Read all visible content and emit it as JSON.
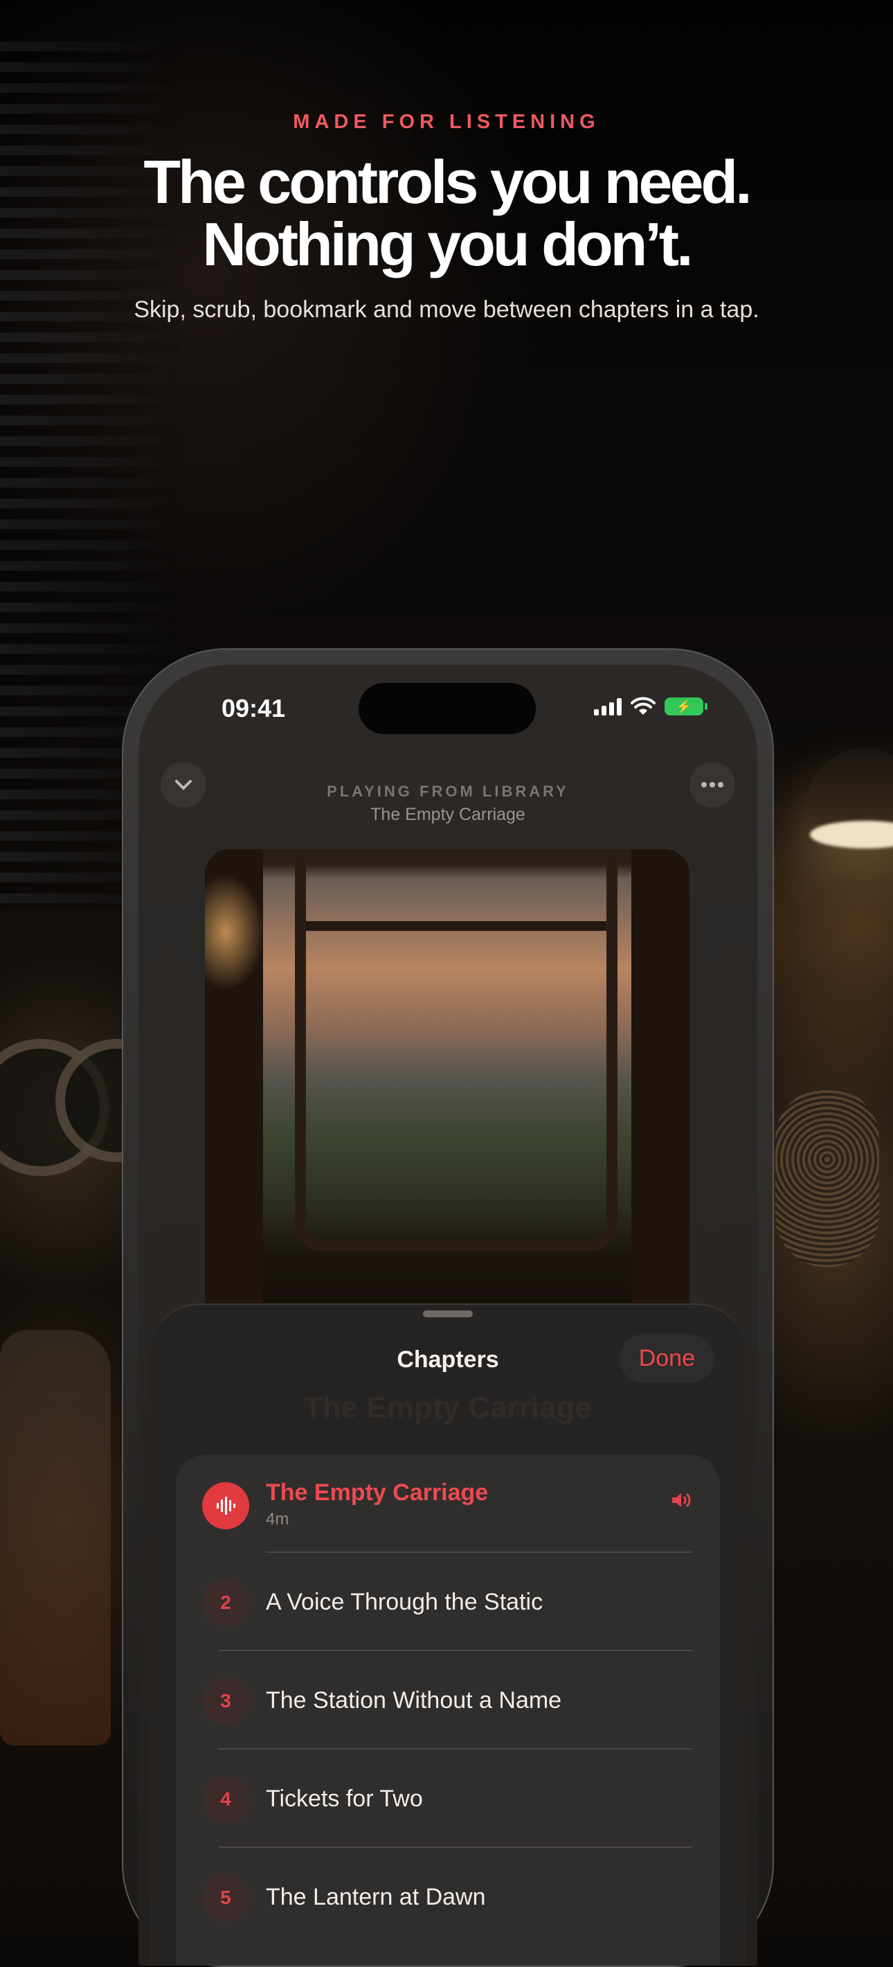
{
  "marketing": {
    "eyebrow": "MADE FOR LISTENING",
    "headline_line1": "The controls you need.",
    "headline_line2": "Nothing you don’t.",
    "subhead": "Skip, scrub, bookmark and move between chapters in a tap."
  },
  "status_bar": {
    "time": "09:41",
    "icons": [
      "cellular-signal-icon",
      "wifi-icon",
      "battery-charging-icon"
    ],
    "battery_color": "#34c759"
  },
  "player": {
    "playing_from": "PLAYING FROM LIBRARY",
    "title": "The Empty Carriage"
  },
  "sheet": {
    "title": "Chapters",
    "done_label": "Done",
    "ghost_title": "The Empty Carriage",
    "chapters": [
      {
        "number": "",
        "title": "The Empty Carriage",
        "duration": "4m",
        "active": true
      },
      {
        "number": "2",
        "title": "A Voice Through the Static"
      },
      {
        "number": "3",
        "title": "The Station Without a Name"
      },
      {
        "number": "4",
        "title": "Tickets for Two"
      },
      {
        "number": "5",
        "title": "The Lantern at Dawn"
      }
    ]
  },
  "colors": {
    "accent": "#e8484d",
    "sheet_bg": "#262423",
    "list_bg": "#302e2d"
  }
}
